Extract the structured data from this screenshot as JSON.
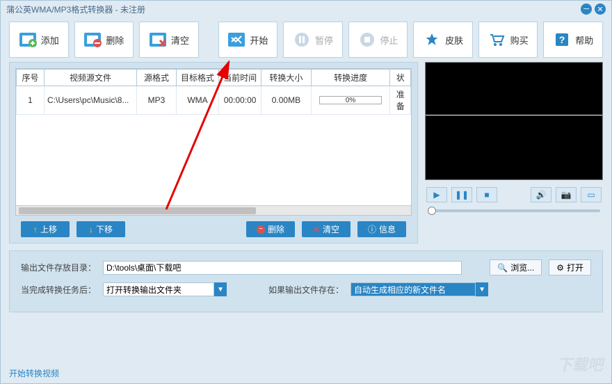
{
  "window": {
    "title": "蒲公英WMA/MP3格式转换器 - 未注册"
  },
  "toolbar": {
    "add": "添加",
    "delete": "删除",
    "clear": "清空",
    "start": "开始",
    "pause": "暂停",
    "stop": "停止",
    "skin": "皮肤",
    "buy": "购买",
    "help": "帮助"
  },
  "table": {
    "headers": [
      "序号",
      "视频源文件",
      "源格式",
      "目标格式",
      "当前时间",
      "转换大小",
      "转换进度",
      "状"
    ],
    "row": {
      "index": "1",
      "source": "C:\\Users\\pc\\Music\\8...",
      "srcFmt": "MP3",
      "tgtFmt": "WMA",
      "time": "00:00:00",
      "size": "0.00MB",
      "progress": "0%",
      "status": "准备"
    }
  },
  "buttons": {
    "moveUp": "上移",
    "moveDown": "下移",
    "delete": "删除",
    "clear": "清空",
    "info": "信息"
  },
  "output": {
    "dirLabel": "输出文件存放目录：",
    "dirValue": "D:\\tools\\桌面\\下载吧",
    "browse": "浏览...",
    "open": "打开",
    "afterLabel": "当完成转换任务后：",
    "afterValue": "打开转换输出文件夹",
    "existsLabel": "如果输出文件存在：",
    "existsValue": "自动生成相应的新文件名"
  },
  "footer": {
    "link": "开始转换视频"
  },
  "watermark": "下载吧"
}
